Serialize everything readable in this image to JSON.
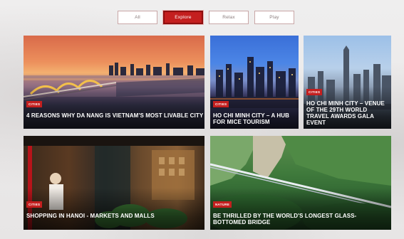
{
  "tabs": [
    {
      "label": "All",
      "active": false
    },
    {
      "label": "Explore",
      "active": true
    },
    {
      "label": "Relax",
      "active": false
    },
    {
      "label": "Play",
      "active": false
    }
  ],
  "cards": [
    {
      "badge": "CITIES",
      "title": "4 REASONS WHY DA NANG IS VIETNAM'S MOST LIVABLE CITY"
    },
    {
      "badge": "CITIES",
      "title": "HO CHI MINH CITY – A HUB FOR MICE TOURISM"
    },
    {
      "badge": "CITIES",
      "title": "HO CHI MINH CITY – VENUE OF THE 29TH WORLD TRAVEL AWARDS GALA EVENT"
    },
    {
      "badge": "CITIES",
      "title": "SHOPPING IN HANOI - MARKETS AND MALLS"
    },
    {
      "badge": "NATURE",
      "title": "BE THRILLED BY THE WORLD'S LONGEST GLASS-BOTTOMED BRIDGE"
    }
  ],
  "colors": {
    "accent": "#c41f1f",
    "tab_border": "#c9a7a7",
    "page_bg": "#eceaea"
  }
}
